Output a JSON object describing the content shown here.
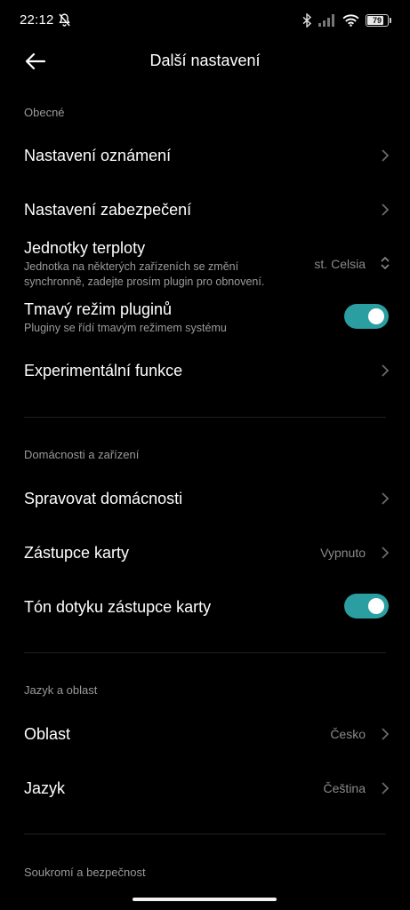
{
  "status": {
    "time": "22:12",
    "battery": "79"
  },
  "header": {
    "title": "Další nastavení"
  },
  "sections": {
    "general": {
      "title": "Obecné",
      "notifications": "Nastavení oznámení",
      "security": "Nastavení zabezpečení",
      "temp_title": "Jednotky terploty",
      "temp_sub": "Jednotka na některých zařízeních se změní synchronně, zadejte prosím plugin pro obnovení.",
      "temp_value": "st. Celsia",
      "dark_title": "Tmavý režim pluginů",
      "dark_sub": "Pluginy se řídí tmavým režimem systému",
      "dark_enabled": true,
      "experimental": "Experimentální funkce"
    },
    "homes": {
      "title": "Domácnosti a zařízení",
      "manage": "Spravovat domácnosti",
      "card_proxy": "Zástupce karty",
      "card_proxy_value": "Vypnuto",
      "card_tone": "Tón dotyku zástupce karty",
      "card_tone_enabled": true
    },
    "language": {
      "title": "Jazyk a oblast",
      "region": "Oblast",
      "region_value": "Česko",
      "language": "Jazyk",
      "language_value": "Čeština"
    },
    "privacy": {
      "title": "Soukromí a bezpečnost"
    }
  },
  "colors": {
    "background": "#000000",
    "toggle_on": "#2a9ea0",
    "secondary_text": "#9a9a9a"
  }
}
